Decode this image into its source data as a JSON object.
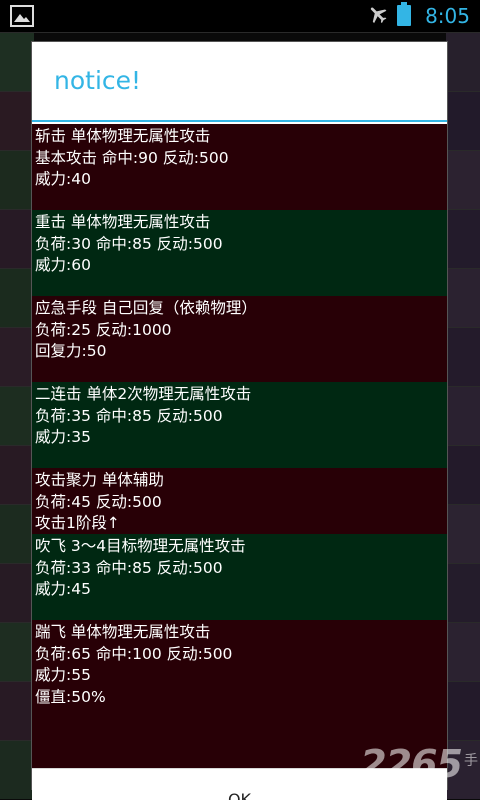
{
  "status_bar": {
    "time": "8:05",
    "icons": [
      "image-notification-icon",
      "airplane-mode-icon",
      "battery-icon"
    ]
  },
  "colors": {
    "accent": "#33b5e5",
    "entry_red": "#280006",
    "entry_green": "#002812"
  },
  "dialog": {
    "title": "notice!",
    "ok_label": "OK",
    "entries": [
      {
        "lines": [
          "斩击 单体物理无属性攻击",
          "基本攻击 命中:90 反动:500",
          "威力:40"
        ],
        "tone": "red"
      },
      {
        "lines": [
          "重击 单体物理无属性攻击",
          "负荷:30 命中:85 反动:500",
          "威力:60"
        ],
        "tone": "green"
      },
      {
        "lines": [
          "应急手段 自己回复（依赖物理）",
          "负荷:25 反动:1000",
          "回复力:50"
        ],
        "tone": "red"
      },
      {
        "lines": [
          "二连击 单体2次物理无属性攻击",
          "负荷:35 命中:85 反动:500",
          "威力:35"
        ],
        "tone": "green"
      },
      {
        "lines": [
          "攻击聚力 单体辅助",
          "负荷:45 反动:500",
          "攻击1阶段↑"
        ],
        "tone": "red"
      },
      {
        "lines": [
          "吹飞 3～4目标物理无属性攻击",
          "负荷:33 命中:85 反动:500",
          "威力:45"
        ],
        "tone": "green"
      },
      {
        "lines": [
          "踹飞 单体物理无属性攻击",
          "负荷:65 命中:100 反动:500",
          "威力:55",
          "僵直:50%"
        ],
        "tone": "red"
      }
    ]
  },
  "watermark": {
    "text": "2265",
    "suffix": "手"
  }
}
